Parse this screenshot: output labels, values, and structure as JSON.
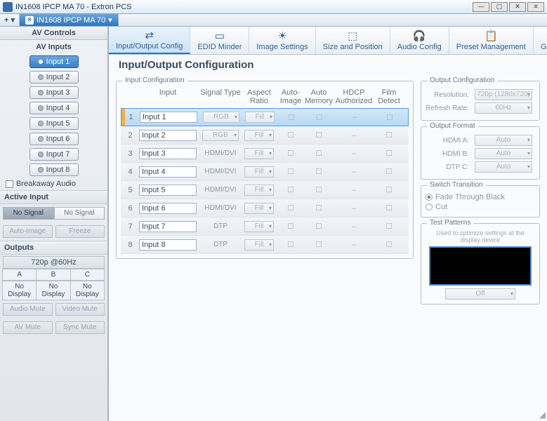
{
  "window": {
    "title": "IN1608 IPCP MA 70 - Extron PCS",
    "tab": "IN1608 IPCP MA 70"
  },
  "sidebar": {
    "header": "AV Controls",
    "inputs_label": "AV Inputs",
    "inputs": [
      "Input 1",
      "Input 2",
      "Input 3",
      "Input 4",
      "Input 5",
      "Input 6",
      "Input 7",
      "Input 8"
    ],
    "breakaway": "Breakaway Audio",
    "active_input": "Active Input",
    "nosignal": "No Signal",
    "auto_image": "Auto-Image",
    "freeze": "Freeze",
    "outputs_label": "Outputs",
    "resolution": "720p @60Hz",
    "col": [
      "A",
      "B",
      "C"
    ],
    "nd": "No Display",
    "mute": [
      "Audio Mute",
      "Video Mute",
      "AV Mute",
      "Sync Mute"
    ]
  },
  "toolbar": [
    {
      "l": "Input/Output Config",
      "g": "⇄"
    },
    {
      "l": "EDID Minder",
      "g": "▭"
    },
    {
      "l": "Image Settings",
      "g": "☀"
    },
    {
      "l": "Size and Position",
      "g": "⬚"
    },
    {
      "l": "Audio Config",
      "g": "🎧"
    },
    {
      "l": "Preset Management",
      "g": "📋"
    },
    {
      "l": "General Settings",
      "g": "⚙"
    }
  ],
  "page": {
    "title": "Input/Output Configuration",
    "input_cfg": "Input Configuration",
    "headers": {
      "input": "Input",
      "sig": "Signal Type",
      "ar": "Aspect Ratio",
      "ai": "Auto-Image",
      "am": "Auto Memory",
      "hd": "HDCP Authorized",
      "fd": "Film Detect"
    },
    "rows": [
      {
        "n": "1",
        "name": "Input 1",
        "sig": "RGB",
        "ar": "Fill"
      },
      {
        "n": "2",
        "name": "Input 2",
        "sig": "RGB",
        "ar": "Fill"
      },
      {
        "n": "3",
        "name": "Input 3",
        "sig": "HDMI/DVI",
        "ar": "Fill"
      },
      {
        "n": "4",
        "name": "Input 4",
        "sig": "HDMI/DVI",
        "ar": "Fill"
      },
      {
        "n": "5",
        "name": "Input 5",
        "sig": "HDMI/DVI",
        "ar": "Fill"
      },
      {
        "n": "6",
        "name": "Input 6",
        "sig": "HDMI/DVI",
        "ar": "Fill"
      },
      {
        "n": "7",
        "name": "Input 7",
        "sig": "DTP",
        "ar": "Fill"
      },
      {
        "n": "8",
        "name": "Input 8",
        "sig": "DTP",
        "ar": "Fill"
      }
    ],
    "out_cfg": "Output Configuration",
    "res": "Resolution:",
    "res_v": "720p (1280x720)",
    "rr": "Refresh Rate:",
    "rr_v": "60Hz",
    "of": "Output Format",
    "ha": "HDMI A:",
    "hb": "HDMI B:",
    "dc": "DTP C:",
    "auto": "Auto",
    "st": "Switch Transition",
    "fade": "Fade Through Black",
    "cut": "Cut",
    "tp": "Test Patterns",
    "note": "Used to optimize settings at the display device",
    "off": "Off",
    "dash": "–"
  }
}
